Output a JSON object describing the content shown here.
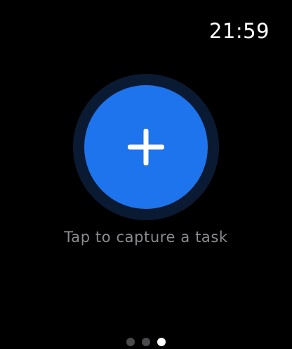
{
  "status": {
    "time": "21:59"
  },
  "capture": {
    "button_icon": "plus-icon",
    "caption": "Tap to capture a task",
    "accent_color": "#1e74ec",
    "ring_color": "#0b1a33"
  },
  "pager": {
    "page_count": 3,
    "current_page": 3
  }
}
